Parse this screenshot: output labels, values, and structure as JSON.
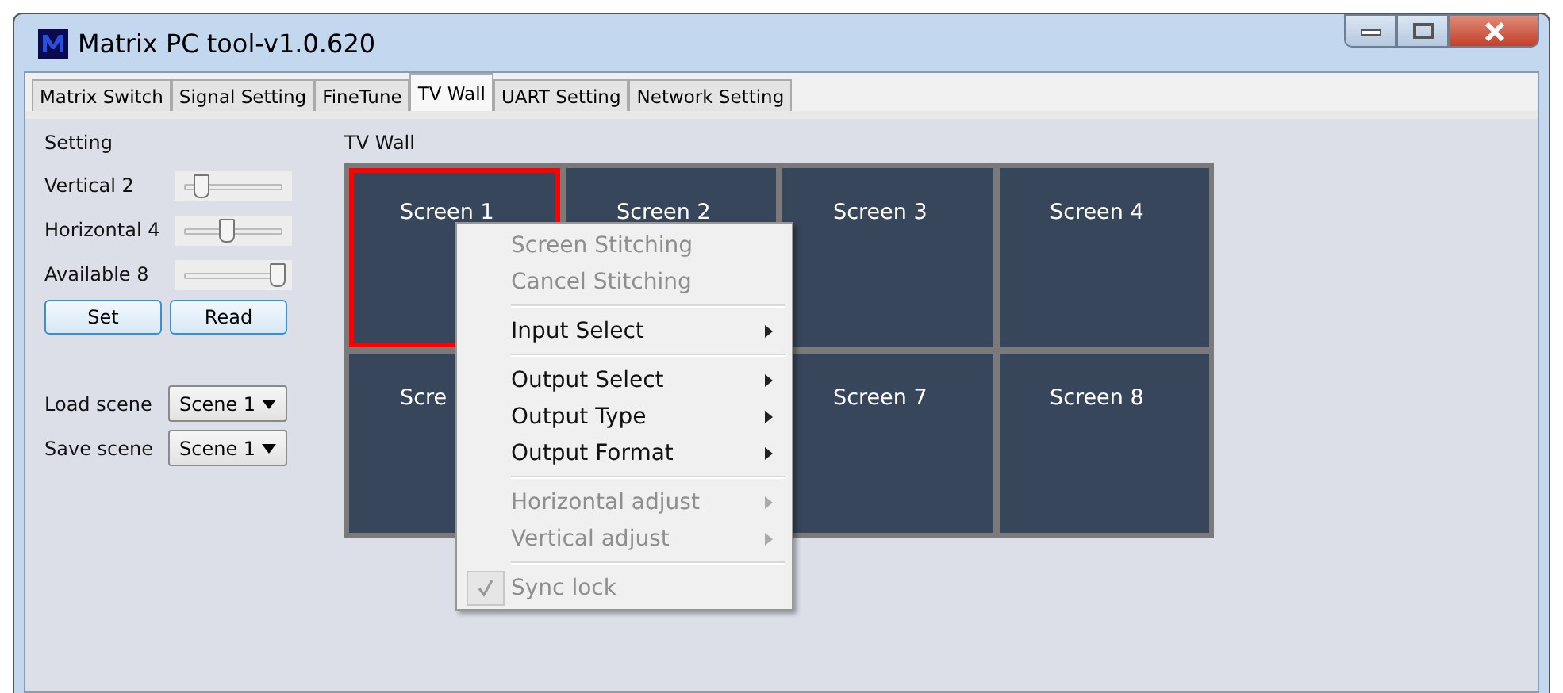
{
  "window": {
    "title": "Matrix PC tool-v1.0.620"
  },
  "tabs": [
    {
      "label": "Matrix Switch",
      "selected": false
    },
    {
      "label": "Signal Setting",
      "selected": false
    },
    {
      "label": "FineTune",
      "selected": false
    },
    {
      "label": "TV Wall",
      "selected": true
    },
    {
      "label": "UART Setting",
      "selected": false
    },
    {
      "label": "Network Setting",
      "selected": false
    }
  ],
  "setting": {
    "title": "Setting",
    "sliders": [
      {
        "label": "Vertical 2",
        "level": 0.14
      },
      {
        "label": "Horizontal 4",
        "level": 0.43
      },
      {
        "label": "Available 8",
        "level": 1
      }
    ],
    "buttons": [
      "Set",
      "Read"
    ],
    "scenes": [
      {
        "label": "Load scene",
        "value": "Scene 1"
      },
      {
        "label": "Save scene",
        "value": "Scene 1"
      }
    ]
  },
  "tv_wall": {
    "title": "TV Wall",
    "screens": [
      {
        "label": "Screen 1",
        "selected": true
      },
      {
        "label": "Screen 2",
        "selected": false
      },
      {
        "label": "Screen 3",
        "selected": false
      },
      {
        "label": "Screen 4",
        "selected": false
      },
      {
        "label": "Scre",
        "selected": false
      },
      {
        "label": "Screen 7",
        "selected": false
      },
      {
        "label": "Screen 8",
        "selected": false
      }
    ]
  },
  "context_menu": [
    {
      "kind": "item",
      "label": "Screen Stitching",
      "disabled": true,
      "submenu": false,
      "checked": false
    },
    {
      "kind": "item",
      "label": "Cancel Stitching",
      "disabled": true,
      "submenu": false,
      "checked": false
    },
    {
      "kind": "separator"
    },
    {
      "kind": "item",
      "label": "Input Select",
      "disabled": false,
      "submenu": true,
      "checked": false
    },
    {
      "kind": "separator"
    },
    {
      "kind": "item",
      "label": "Output Select",
      "disabled": false,
      "submenu": true,
      "checked": false
    },
    {
      "kind": "item",
      "label": "Output Type",
      "disabled": false,
      "submenu": true,
      "checked": false
    },
    {
      "kind": "item",
      "label": "Output Format",
      "disabled": false,
      "submenu": true,
      "checked": false
    },
    {
      "kind": "separator"
    },
    {
      "kind": "item",
      "label": "Horizontal adjust",
      "disabled": true,
      "submenu": true,
      "checked": false
    },
    {
      "kind": "item",
      "label": "Vertical adjust",
      "disabled": true,
      "submenu": true,
      "checked": false
    },
    {
      "kind": "separator"
    },
    {
      "kind": "item",
      "label": "Sync lock",
      "disabled": true,
      "submenu": false,
      "checked": true
    }
  ]
}
